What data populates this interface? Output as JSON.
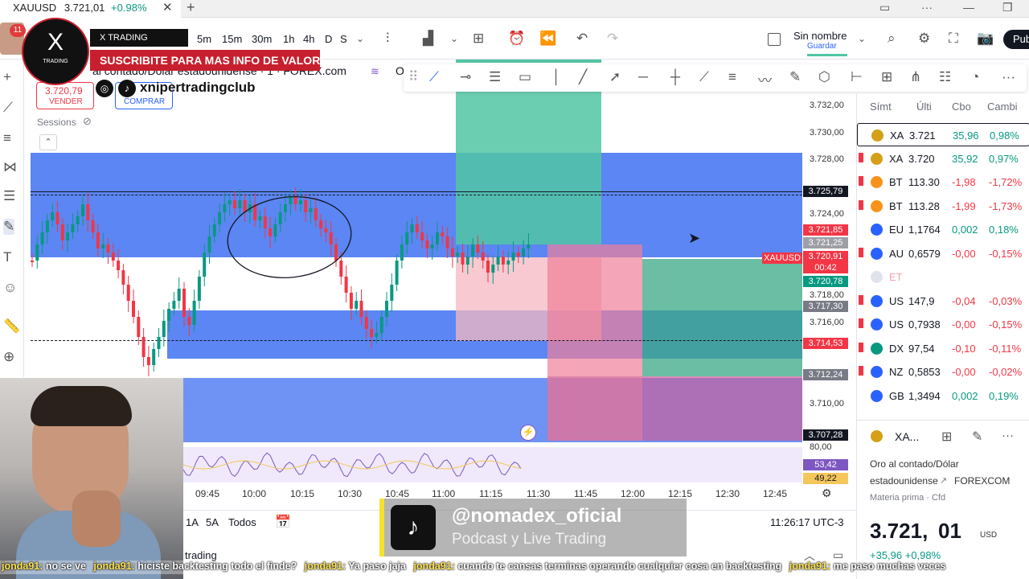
{
  "browser": {
    "tab_title": "XAUUSD",
    "tab_price": "3.721,01",
    "tab_change": "+0.98%",
    "close_icon": "close-icon",
    "new_tab_icon": "plus-icon"
  },
  "toolbar": {
    "timeframes": [
      "5m",
      "15m",
      "30m",
      "1h",
      "4h",
      "D",
      "S"
    ],
    "layout_name": "Sin nombre",
    "layout_status": "Guardar",
    "publish_label": "Pub"
  },
  "symbol_bar": {
    "description": "al contado/Dólar estadounidense · 1 · FOREX.com",
    "sell_price": "3.720,79",
    "sell_label": "VENDER",
    "buy_label": "COMPRAR",
    "sessions_label": "Sessions"
  },
  "chart_data": {
    "type": "candlestick",
    "symbol": "XAUUSD",
    "price_ticks": [
      "3.732,00",
      "3.730,00",
      "3.728,00",
      "3.724,00",
      "3.718,00",
      "3.716,00",
      "3.710,00"
    ],
    "time_ticks": [
      "09:45",
      "10:00",
      "10:15",
      "10:30",
      "10:45",
      "11:00",
      "11:15",
      "11:30",
      "11:45",
      "12:00",
      "12:15",
      "12:30",
      "12:45"
    ],
    "price_labels": [
      {
        "text": "3.725,79",
        "color": "#131722"
      },
      {
        "text": "3.721,85",
        "color": "#f23645"
      },
      {
        "text": "3.721,25",
        "color": "#9e9ea6"
      },
      {
        "text": "3.720,91",
        "color": "#f23645"
      },
      {
        "text": "00:42",
        "color": "#f23645"
      },
      {
        "text": "3.720,78",
        "color": "#089981"
      },
      {
        "text": "3.717,30",
        "color": "#787b86"
      },
      {
        "text": "3.714,53",
        "color": "#f23645"
      },
      {
        "text": "3.712,24",
        "color": "#787b86"
      },
      {
        "text": "3.707,28",
        "color": "#131722"
      }
    ],
    "symbol_tag": "XAUUSD",
    "rsi_top": "80,00",
    "rsi_values": [
      "53,42",
      "49,22"
    ]
  },
  "bottom_bar": {
    "ranges": [
      "1A",
      "5A",
      "Todos"
    ],
    "clock": "11:26:17 UTC-3",
    "panel_tab": "trading"
  },
  "watchlist": {
    "headers": [
      "Símt",
      "Últi",
      "Cbo",
      "Cambi"
    ],
    "rows": [
      {
        "sym": "XA",
        "last": "3.721",
        "chg": "35,96",
        "pct": "0,98%",
        "dir": "pos",
        "color": "#d4a017"
      },
      {
        "sym": "XA",
        "last": "3.720",
        "chg": "35,92",
        "pct": "0,97%",
        "dir": "pos",
        "color": "#d4a017"
      },
      {
        "sym": "BT",
        "last": "113.30",
        "chg": "-1,98",
        "pct": "-1,72%",
        "dir": "neg",
        "color": "#f7931a"
      },
      {
        "sym": "BT",
        "last": "113.28",
        "chg": "-1,99",
        "pct": "-1,73%",
        "dir": "neg",
        "color": "#f7931a"
      },
      {
        "sym": "EU",
        "last": "1,1764",
        "chg": "0,002",
        "pct": "0,18%",
        "dir": "pos",
        "color": "#2962ff"
      },
      {
        "sym": "AU",
        "last": "0,6579",
        "chg": "-0,00",
        "pct": "-0,15%",
        "dir": "neg",
        "color": "#2962ff"
      },
      {
        "sym": "ET",
        "last": "",
        "chg": "",
        "pct": "",
        "dir": "dim",
        "color": "#e0e3eb"
      },
      {
        "sym": "US",
        "last": "147,9",
        "chg": "-0,04",
        "pct": "-0,03%",
        "dir": "neg",
        "color": "#2962ff"
      },
      {
        "sym": "US",
        "last": "0,7938",
        "chg": "-0,00",
        "pct": "-0,15%",
        "dir": "neg",
        "color": "#2962ff"
      },
      {
        "sym": "DX",
        "last": "97,54",
        "chg": "-0,10",
        "pct": "-0,11%",
        "dir": "neg",
        "color": "#089981"
      },
      {
        "sym": "NZ",
        "last": "0,5853",
        "chg": "-0,00",
        "pct": "-0,02%",
        "dir": "neg",
        "color": "#2962ff"
      },
      {
        "sym": "GB",
        "last": "1,3494",
        "chg": "0,002",
        "pct": "0,19%",
        "dir": "pos",
        "color": "#2962ff"
      }
    ]
  },
  "details": {
    "symbol": "XA...",
    "name_line1": "Oro al contado/Dólar",
    "name_line2": "estadounidense",
    "exchange": "FOREXCOM",
    "category": "Materia prima · Cfd",
    "price_main": "3.721,",
    "price_decimals": "01",
    "currency": "USD",
    "change": "+35,96 +0,98%"
  },
  "overlays": {
    "brand_name": "X TRADING ACADEMIA",
    "brand_logo_text": "X",
    "brand_logo_sub": "TRADING",
    "cta": "SUSCRIBITE PARA MAS INFO DE VALOR!",
    "social_handle": "xnipertradingclub",
    "notification_count": "11",
    "tiktok_handle": "@nomadex_oficial",
    "tiktok_tagline": "Podcast y Live Trading",
    "chat": [
      {
        "user": "jonda91:",
        "msg": "no se ve"
      },
      {
        "user": "jonda91:",
        "msg": "hiciste backtesting todo el finde?"
      },
      {
        "user": "jonda91:",
        "msg": "Ya paso jaja"
      },
      {
        "user": "jonda91:",
        "msg": "cuando te cansas terminas operando cualquier cosa en backtesting"
      },
      {
        "user": "jonda91:",
        "msg": "me paso muchas veces"
      }
    ]
  },
  "colors": {
    "zone_blue": "#4f7bf2",
    "long_green": "#26a69a",
    "short_red": "#f7a6b4",
    "candle_up": "#089981",
    "candle_down": "#f23645",
    "accent": "#2962ff"
  }
}
